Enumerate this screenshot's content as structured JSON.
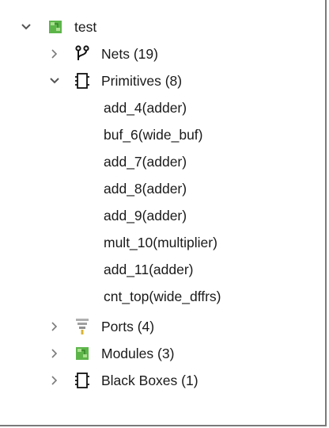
{
  "tree": {
    "root": {
      "label": "test",
      "expanded": true,
      "icon": "module-icon"
    },
    "nets": {
      "label": "Nets (19)",
      "expanded": false,
      "icon": "nets-fork-icon"
    },
    "primitives": {
      "label": "Primitives (8)",
      "expanded": true,
      "icon": "black-box-icon",
      "items": [
        "add_4(adder)",
        "buf_6(wide_buf)",
        "add_7(adder)",
        "add_8(adder)",
        "add_9(adder)",
        "mult_10(multiplier)",
        "add_11(adder)",
        "cnt_top(wide_dffrs)"
      ]
    },
    "ports": {
      "label": "Ports (4)",
      "expanded": false,
      "icon": "funnel-icon"
    },
    "modules": {
      "label": "Modules (3)",
      "expanded": false,
      "icon": "module-icon"
    },
    "black_boxes": {
      "label": "Black Boxes (1)",
      "expanded": false,
      "icon": "black-box-icon"
    }
  },
  "colors": {
    "text": "#1a1a1a",
    "chevron": "#6b6b6b",
    "module_green": "#5db54a",
    "funnel_gray": "#9a9a9a",
    "funnel_gold": "#d9b436"
  }
}
